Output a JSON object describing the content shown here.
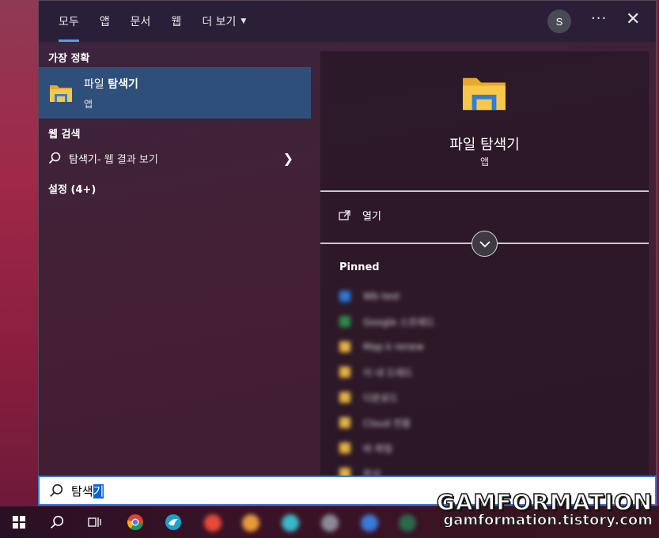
{
  "topbar": {
    "tabs": [
      {
        "label": "모두",
        "active": true
      },
      {
        "label": "앱"
      },
      {
        "label": "문서"
      },
      {
        "label": "웹"
      },
      {
        "label": "더 보기"
      }
    ],
    "avatar_initial": "S",
    "more_label": "···",
    "close_label": "✕"
  },
  "left": {
    "best_match_header": "가장 정확",
    "best_match": {
      "title_prefix": "파일 ",
      "title_bold": "탐색기",
      "subtitle": "앱"
    },
    "web_header": "웹 검색",
    "web_query": "탐색기",
    "web_suffix": " - 웹 결과 보기",
    "settings_header": "설정 (4+)"
  },
  "right": {
    "app_title": "파일 탐색기",
    "app_subtitle": "앱",
    "open_label": "열기",
    "pinned_header": "Pinned",
    "pinned_items": [
      {
        "label": "Wb test",
        "color": "#2a7ad6"
      },
      {
        "label": "Google 스프레드",
        "color": "#2f8a4a"
      },
      {
        "label": "Map k renew",
        "color": "#e3b341"
      },
      {
        "label": "이 내 드레드",
        "color": "#e3b341"
      },
      {
        "label": "다운로드",
        "color": "#e3b341"
      },
      {
        "label": "Cloud 전용",
        "color": "#e3b341"
      },
      {
        "label": "바 파일",
        "color": "#e3b341"
      },
      {
        "label": "문서",
        "color": "#e3b341"
      }
    ]
  },
  "search": {
    "typed": "탐색",
    "selected": "기"
  },
  "watermark": {
    "line1": "GAMFORMATION",
    "line2": "gamformation.tistory.com"
  },
  "colors": {
    "accent": "#4d9ef0",
    "highlight": "#2e4f7a",
    "search_border": "#3b78d8",
    "selection": "#0a64d6"
  },
  "taskbar": {
    "icons": [
      "windows-start-icon",
      "search-icon",
      "task-view-icon",
      "chrome-icon",
      "app-bird-icon"
    ]
  }
}
